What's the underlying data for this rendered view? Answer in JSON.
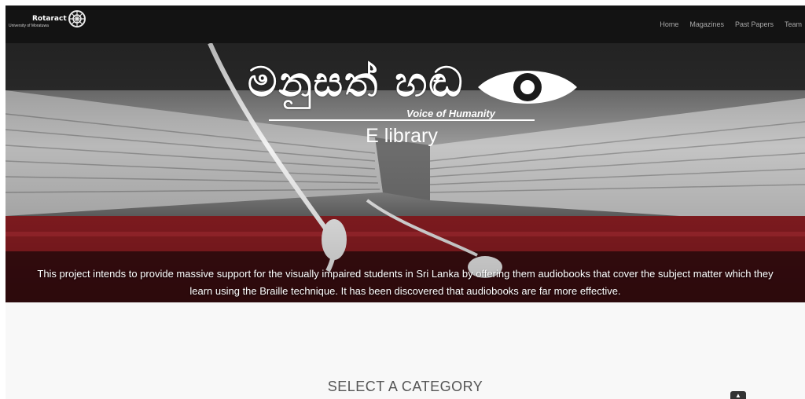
{
  "brand": {
    "name": "Rotaract",
    "subtitle": "University of Moratuwa"
  },
  "nav": {
    "items": [
      {
        "label": "Home"
      },
      {
        "label": "Magazines"
      },
      {
        "label": "Past Papers"
      },
      {
        "label": "Team"
      }
    ]
  },
  "hero": {
    "logo_text": "මනුසත් හඬ",
    "logo_tagline": "Voice of Humanity",
    "subtitle": "E library",
    "description": "This project intends to provide massive support for the visually impaired students in Sri Lanka by offering them audiobooks that cover the subject matter which they learn using the Braille technique. It has been discovered that audiobooks are far more effective."
  },
  "section": {
    "title": "SELECT A CATEGORY"
  },
  "icons": {
    "brand_wheel": "rotary-wheel-icon",
    "logo_eye": "eye-icon",
    "back_to_top": "chevron-up-icon"
  },
  "colors": {
    "navbar": "#131313",
    "nav_link": "#a8a8a8",
    "hero_accent": "#7a1a1e",
    "section_bg": "#f8f8f8"
  }
}
